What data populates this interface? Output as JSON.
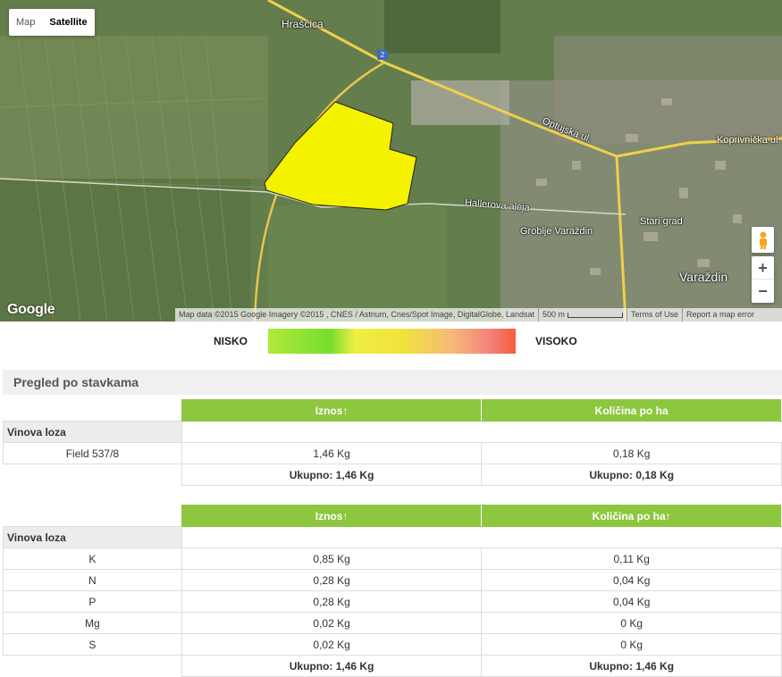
{
  "map": {
    "maptype": {
      "map": "Map",
      "satellite": "Satellite"
    },
    "labels": {
      "hrascica": "Hrašćica",
      "optujska": "Optujska ul.",
      "koprivnicka": "Koprivnička ul.",
      "hallerova": "Hallerova aleja",
      "groblje": "Groblje Varaždin",
      "stari_grad": "Stari grad",
      "varazdin": "Varaždin",
      "road_number": "2"
    },
    "google": "Google",
    "attribution": {
      "data": "Map data ©2015 Google Imagery ©2015 , CNES / Astrium, Cnes/Spot Image, DigitalGlobe, Landsat",
      "scale": "500 m",
      "terms": "Terms of Use",
      "report": "Report a map error"
    },
    "zoom": {
      "in": "+",
      "out": "−"
    },
    "field_color": "#f5f200"
  },
  "legend": {
    "low": "NISKO",
    "high": "VISOKO"
  },
  "section_title": "Pregled po stavkama",
  "table1": {
    "headers": [
      "",
      "Iznos↑",
      "Količina po ha"
    ],
    "group": "Vinova loza",
    "rows": [
      {
        "name": "Field 537/8",
        "iznos": "1,46 Kg",
        "kolicina": "0,18 Kg"
      }
    ],
    "total": {
      "iznos": "Ukupno: 1,46 Kg",
      "kolicina": "Ukupno: 0,18 Kg"
    }
  },
  "table2": {
    "headers": [
      "",
      "Iznos↑",
      "Količina po ha↑"
    ],
    "group": "Vinova loza",
    "rows": [
      {
        "name": "K",
        "iznos": "0,85 Kg",
        "kolicina": "0,11 Kg"
      },
      {
        "name": "N",
        "iznos": "0,28 Kg",
        "kolicina": "0,04 Kg"
      },
      {
        "name": "P",
        "iznos": "0,28 Kg",
        "kolicina": "0,04 Kg"
      },
      {
        "name": "Mg",
        "iznos": "0,02 Kg",
        "kolicina": "0 Kg"
      },
      {
        "name": "S",
        "iznos": "0,02 Kg",
        "kolicina": "0 Kg"
      }
    ],
    "total": {
      "iznos": "Ukupno: 1,46 Kg",
      "kolicina": "Ukupno: 1,46 Kg"
    }
  }
}
